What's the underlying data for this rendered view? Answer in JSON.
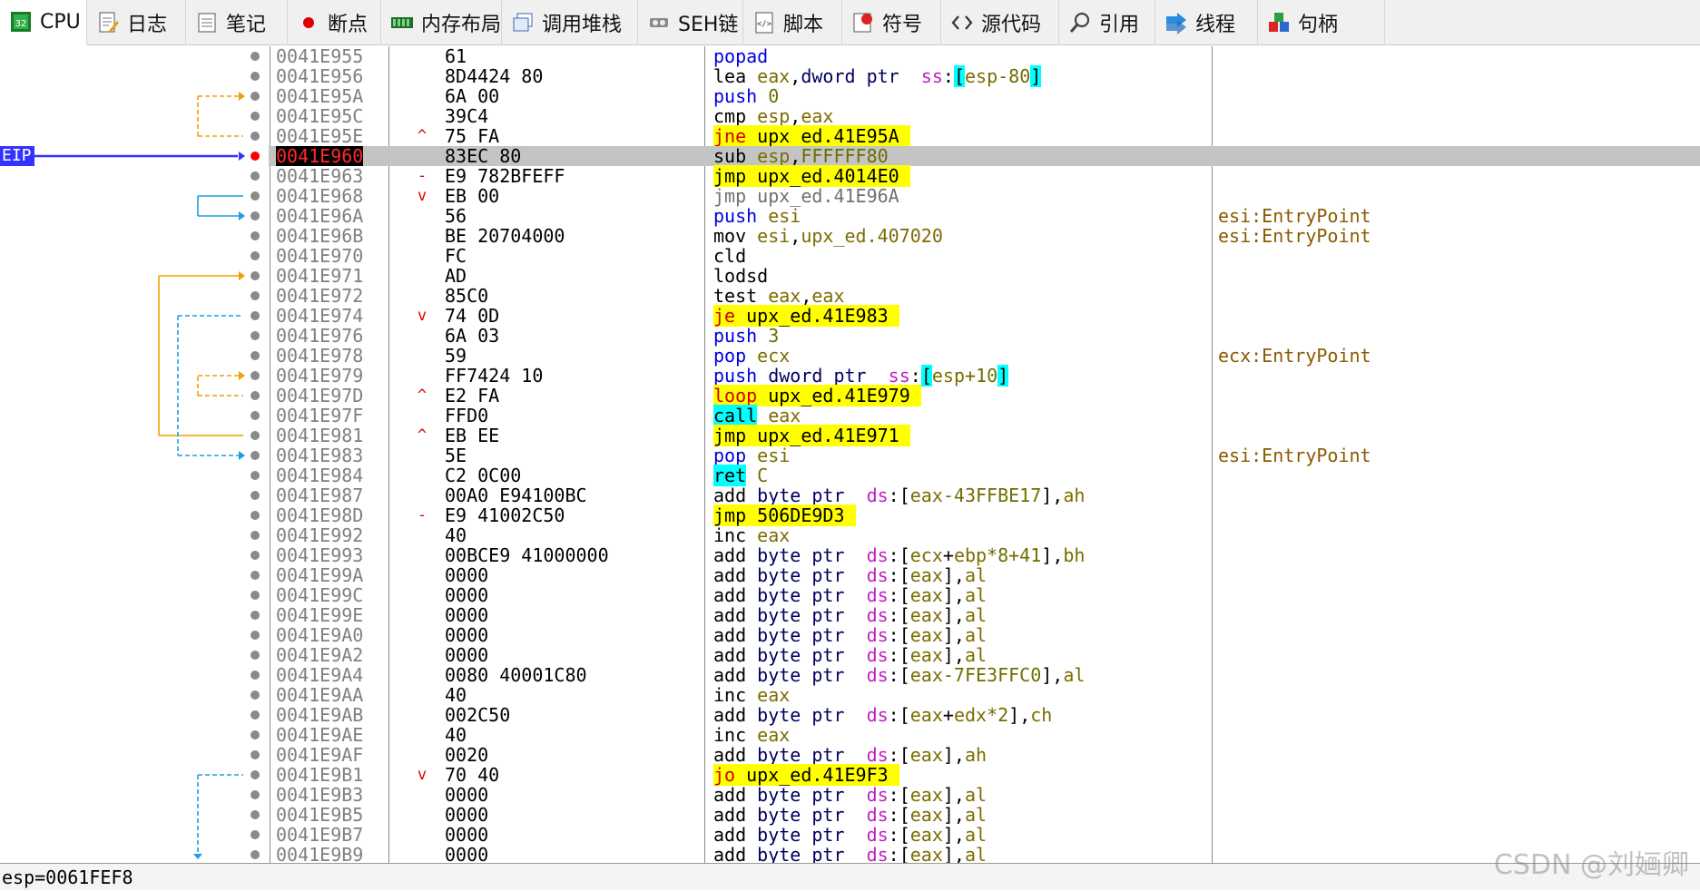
{
  "tabs": [
    {
      "label": "CPU",
      "icon": "cpu-icon",
      "active": true
    },
    {
      "label": "日志",
      "icon": "log-icon"
    },
    {
      "label": "笔记",
      "icon": "notes-icon"
    },
    {
      "label": "断点",
      "icon": "breakpoint-icon"
    },
    {
      "label": "内存布局",
      "icon": "memory-map-icon"
    },
    {
      "label": "调用堆栈",
      "icon": "call-stack-icon"
    },
    {
      "label": "SEH链",
      "icon": "seh-chain-icon"
    },
    {
      "label": "脚本",
      "icon": "script-icon"
    },
    {
      "label": "符号",
      "icon": "symbols-icon"
    },
    {
      "label": "源代码",
      "icon": "source-code-icon"
    },
    {
      "label": "引用",
      "icon": "references-icon"
    },
    {
      "label": "线程",
      "icon": "threads-icon"
    },
    {
      "label": "句柄",
      "icon": "handles-icon"
    }
  ],
  "eip_label": "EIP",
  "rows": [
    {
      "addr": "0041E955",
      "bytes": "61",
      "jm": "",
      "dis": [
        [
          "popad",
          "tk-blue",
          ""
        ]
      ]
    },
    {
      "addr": "0041E956",
      "bytes": "8D4424 80",
      "jm": "",
      "dis": [
        [
          "lea ",
          "tk-mn",
          ""
        ],
        [
          "eax",
          "tk-reg",
          ""
        ],
        [
          ",",
          "tk-mn",
          ""
        ],
        [
          "dword ptr ",
          "tk-ptr",
          ""
        ],
        [
          " ss",
          "tk-seg",
          ""
        ],
        [
          ":",
          "tk-mn",
          ""
        ],
        [
          "[",
          "tk-mn",
          "hl-c"
        ],
        [
          "esp",
          "tk-reg",
          ""
        ],
        [
          "-80",
          "tk-imm",
          ""
        ],
        [
          "]",
          "tk-mn",
          "hl-c"
        ]
      ]
    },
    {
      "addr": "0041E95A",
      "bytes": "6A 00",
      "jm": "",
      "dis": [
        [
          "push ",
          "tk-blue",
          ""
        ],
        [
          "0",
          "tk-imm",
          ""
        ]
      ]
    },
    {
      "addr": "0041E95C",
      "bytes": "39C4",
      "jm": "",
      "dis": [
        [
          "cmp ",
          "tk-mn",
          ""
        ],
        [
          "esp",
          "tk-reg",
          ""
        ],
        [
          ",",
          "tk-mn",
          ""
        ],
        [
          "eax",
          "tk-reg",
          ""
        ]
      ]
    },
    {
      "addr": "0041E95E",
      "bytes": "75 FA",
      "jm": "^",
      "dis": [
        [
          "jne",
          "tk-red",
          "hl-y"
        ],
        [
          " upx_ed.41E95A ",
          "tk-mn",
          "hl-y"
        ]
      ]
    },
    {
      "addr": "0041E960",
      "bytes": "83EC 80",
      "jm": "",
      "eip": true,
      "dis": [
        [
          "sub ",
          "tk-mn",
          ""
        ],
        [
          "esp",
          "tk-reg",
          ""
        ],
        [
          ",",
          "tk-mn",
          ""
        ],
        [
          "FFFFFF80",
          "tk-imm",
          ""
        ]
      ]
    },
    {
      "addr": "0041E963",
      "bytes": "E9 782BFEFF",
      "jm": "-",
      "dis": [
        [
          "jmp ",
          "tk-mn",
          "hl-y"
        ],
        [
          "upx_ed.4014E0 ",
          "tk-mn",
          "hl-y"
        ]
      ]
    },
    {
      "addr": "0041E968",
      "bytes": "EB 00",
      "jm": "v",
      "dis": [
        [
          "jmp upx_ed.41E96A",
          "tk-gray",
          ""
        ]
      ]
    },
    {
      "addr": "0041E96A",
      "bytes": "56",
      "jm": "",
      "dis": [
        [
          "push ",
          "tk-blue",
          ""
        ],
        [
          "esi",
          "tk-reg",
          ""
        ]
      ],
      "cmt": "esi:EntryPoint"
    },
    {
      "addr": "0041E96B",
      "bytes": "BE 20704000",
      "jm": "",
      "dis": [
        [
          "mov ",
          "tk-mn",
          ""
        ],
        [
          "esi",
          "tk-reg",
          ""
        ],
        [
          ",",
          "tk-mn",
          ""
        ],
        [
          "upx_ed.407020",
          "tk-addr",
          ""
        ]
      ],
      "cmt": "esi:EntryPoint"
    },
    {
      "addr": "0041E970",
      "bytes": "FC",
      "jm": "",
      "dis": [
        [
          "cld",
          "tk-mn",
          ""
        ]
      ]
    },
    {
      "addr": "0041E971",
      "bytes": "AD",
      "jm": "",
      "dis": [
        [
          "lodsd",
          "tk-mn",
          ""
        ]
      ]
    },
    {
      "addr": "0041E972",
      "bytes": "85C0",
      "jm": "",
      "dis": [
        [
          "test ",
          "tk-mn",
          ""
        ],
        [
          "eax",
          "tk-reg",
          ""
        ],
        [
          ",",
          "tk-mn",
          ""
        ],
        [
          "eax",
          "tk-reg",
          ""
        ]
      ]
    },
    {
      "addr": "0041E974",
      "bytes": "74 0D",
      "jm": "v",
      "dis": [
        [
          "je",
          "tk-red",
          "hl-y"
        ],
        [
          " upx_ed.41E983 ",
          "tk-mn",
          "hl-y"
        ]
      ]
    },
    {
      "addr": "0041E976",
      "bytes": "6A 03",
      "jm": "",
      "dis": [
        [
          "push ",
          "tk-blue",
          ""
        ],
        [
          "3",
          "tk-imm",
          ""
        ]
      ]
    },
    {
      "addr": "0041E978",
      "bytes": "59",
      "jm": "",
      "dis": [
        [
          "pop ",
          "tk-blue",
          ""
        ],
        [
          "ecx",
          "tk-reg",
          ""
        ]
      ],
      "cmt": "ecx:EntryPoint"
    },
    {
      "addr": "0041E979",
      "bytes": "FF7424 10",
      "jm": "",
      "dis": [
        [
          "push ",
          "tk-blue",
          ""
        ],
        [
          "dword ptr ",
          "tk-ptr",
          ""
        ],
        [
          " ss",
          "tk-seg",
          ""
        ],
        [
          ":",
          "tk-mn",
          ""
        ],
        [
          "[",
          "tk-mn",
          "hl-c"
        ],
        [
          "esp",
          "tk-reg",
          ""
        ],
        [
          "+10",
          "tk-imm",
          ""
        ],
        [
          "]",
          "tk-mn",
          "hl-c"
        ]
      ]
    },
    {
      "addr": "0041E97D",
      "bytes": "E2 FA",
      "jm": "^",
      "dis": [
        [
          "loop",
          "tk-red",
          "hl-y"
        ],
        [
          " upx_ed.41E979 ",
          "tk-mn",
          "hl-y"
        ]
      ]
    },
    {
      "addr": "0041E97F",
      "bytes": "FFD0",
      "jm": "",
      "dis": [
        [
          "call",
          "tk-mn",
          "hl-c"
        ],
        [
          " eax",
          "tk-reg",
          ""
        ]
      ]
    },
    {
      "addr": "0041E981",
      "bytes": "EB EE",
      "jm": "^",
      "dis": [
        [
          "jmp ",
          "tk-mn",
          "hl-y"
        ],
        [
          "upx_ed.41E971 ",
          "tk-mn",
          "hl-y"
        ]
      ]
    },
    {
      "addr": "0041E983",
      "bytes": "5E",
      "jm": "",
      "dis": [
        [
          "pop ",
          "tk-blue",
          ""
        ],
        [
          "esi",
          "tk-reg",
          ""
        ]
      ],
      "cmt": "esi:EntryPoint"
    },
    {
      "addr": "0041E984",
      "bytes": "C2 0C00",
      "jm": "",
      "dis": [
        [
          "ret",
          "tk-mn",
          "hl-c"
        ],
        [
          " C",
          "tk-imm",
          ""
        ]
      ]
    },
    {
      "addr": "0041E987",
      "bytes": "00A0 E94100BC",
      "jm": "",
      "dis": [
        [
          "add ",
          "tk-mn",
          ""
        ],
        [
          "byte ptr ",
          "tk-ptr",
          ""
        ],
        [
          " ds",
          "tk-seg",
          ""
        ],
        [
          ":[",
          "tk-mn",
          ""
        ],
        [
          "eax",
          "tk-reg",
          ""
        ],
        [
          "-43FFBE17",
          "tk-imm",
          ""
        ],
        [
          "],",
          "tk-mn",
          ""
        ],
        [
          "ah",
          "tk-reg",
          ""
        ]
      ]
    },
    {
      "addr": "0041E98D",
      "bytes": "E9 41002C50",
      "jm": "-",
      "dis": [
        [
          "jmp ",
          "tk-mn",
          "hl-y"
        ],
        [
          "506DE9D3 ",
          "tk-mn",
          "hl-y"
        ]
      ]
    },
    {
      "addr": "0041E992",
      "bytes": "40",
      "jm": "",
      "dis": [
        [
          "inc ",
          "tk-mn",
          ""
        ],
        [
          "eax",
          "tk-reg",
          ""
        ]
      ]
    },
    {
      "addr": "0041E993",
      "bytes": "00BCE9 41000000",
      "jm": "",
      "dis": [
        [
          "add ",
          "tk-mn",
          ""
        ],
        [
          "byte ptr ",
          "tk-ptr",
          ""
        ],
        [
          " ds",
          "tk-seg",
          ""
        ],
        [
          ":[",
          "tk-mn",
          ""
        ],
        [
          "ecx",
          "tk-reg",
          ""
        ],
        [
          "+",
          "tk-mn",
          ""
        ],
        [
          "ebp",
          "tk-reg",
          ""
        ],
        [
          "*8+41",
          "tk-imm",
          ""
        ],
        [
          "],",
          "tk-mn",
          ""
        ],
        [
          "bh",
          "tk-reg",
          ""
        ]
      ]
    },
    {
      "addr": "0041E99A",
      "bytes": "0000",
      "jm": "",
      "dis": [
        [
          "add ",
          "tk-mn",
          ""
        ],
        [
          "byte ptr ",
          "tk-ptr",
          ""
        ],
        [
          " ds",
          "tk-seg",
          ""
        ],
        [
          ":[",
          "tk-mn",
          ""
        ],
        [
          "eax",
          "tk-reg",
          ""
        ],
        [
          "],",
          "tk-mn",
          ""
        ],
        [
          "al",
          "tk-reg",
          ""
        ]
      ]
    },
    {
      "addr": "0041E99C",
      "bytes": "0000",
      "jm": "",
      "dis": [
        [
          "add ",
          "tk-mn",
          ""
        ],
        [
          "byte ptr ",
          "tk-ptr",
          ""
        ],
        [
          " ds",
          "tk-seg",
          ""
        ],
        [
          ":[",
          "tk-mn",
          ""
        ],
        [
          "eax",
          "tk-reg",
          ""
        ],
        [
          "],",
          "tk-mn",
          ""
        ],
        [
          "al",
          "tk-reg",
          ""
        ]
      ]
    },
    {
      "addr": "0041E99E",
      "bytes": "0000",
      "jm": "",
      "dis": [
        [
          "add ",
          "tk-mn",
          ""
        ],
        [
          "byte ptr ",
          "tk-ptr",
          ""
        ],
        [
          " ds",
          "tk-seg",
          ""
        ],
        [
          ":[",
          "tk-mn",
          ""
        ],
        [
          "eax",
          "tk-reg",
          ""
        ],
        [
          "],",
          "tk-mn",
          ""
        ],
        [
          "al",
          "tk-reg",
          ""
        ]
      ]
    },
    {
      "addr": "0041E9A0",
      "bytes": "0000",
      "jm": "",
      "dis": [
        [
          "add ",
          "tk-mn",
          ""
        ],
        [
          "byte ptr ",
          "tk-ptr",
          ""
        ],
        [
          " ds",
          "tk-seg",
          ""
        ],
        [
          ":[",
          "tk-mn",
          ""
        ],
        [
          "eax",
          "tk-reg",
          ""
        ],
        [
          "],",
          "tk-mn",
          ""
        ],
        [
          "al",
          "tk-reg",
          ""
        ]
      ]
    },
    {
      "addr": "0041E9A2",
      "bytes": "0000",
      "jm": "",
      "dis": [
        [
          "add ",
          "tk-mn",
          ""
        ],
        [
          "byte ptr ",
          "tk-ptr",
          ""
        ],
        [
          " ds",
          "tk-seg",
          ""
        ],
        [
          ":[",
          "tk-mn",
          ""
        ],
        [
          "eax",
          "tk-reg",
          ""
        ],
        [
          "],",
          "tk-mn",
          ""
        ],
        [
          "al",
          "tk-reg",
          ""
        ]
      ]
    },
    {
      "addr": "0041E9A4",
      "bytes": "0080 40001C80",
      "jm": "",
      "dis": [
        [
          "add ",
          "tk-mn",
          ""
        ],
        [
          "byte ptr ",
          "tk-ptr",
          ""
        ],
        [
          " ds",
          "tk-seg",
          ""
        ],
        [
          ":[",
          "tk-mn",
          ""
        ],
        [
          "eax",
          "tk-reg",
          ""
        ],
        [
          "-7FE3FFC0",
          "tk-imm",
          ""
        ],
        [
          "],",
          "tk-mn",
          ""
        ],
        [
          "al",
          "tk-reg",
          ""
        ]
      ]
    },
    {
      "addr": "0041E9AA",
      "bytes": "40",
      "jm": "",
      "dis": [
        [
          "inc ",
          "tk-mn",
          ""
        ],
        [
          "eax",
          "tk-reg",
          ""
        ]
      ]
    },
    {
      "addr": "0041E9AB",
      "bytes": "002C50",
      "jm": "",
      "dis": [
        [
          "add ",
          "tk-mn",
          ""
        ],
        [
          "byte ptr ",
          "tk-ptr",
          ""
        ],
        [
          " ds",
          "tk-seg",
          ""
        ],
        [
          ":[",
          "tk-mn",
          ""
        ],
        [
          "eax",
          "tk-reg",
          ""
        ],
        [
          "+",
          "tk-mn",
          ""
        ],
        [
          "edx",
          "tk-reg",
          ""
        ],
        [
          "*2",
          "tk-imm",
          ""
        ],
        [
          "],",
          "tk-mn",
          ""
        ],
        [
          "ch",
          "tk-reg",
          ""
        ]
      ]
    },
    {
      "addr": "0041E9AE",
      "bytes": "40",
      "jm": "",
      "dis": [
        [
          "inc ",
          "tk-mn",
          ""
        ],
        [
          "eax",
          "tk-reg",
          ""
        ]
      ]
    },
    {
      "addr": "0041E9AF",
      "bytes": "0020",
      "jm": "",
      "dis": [
        [
          "add ",
          "tk-mn",
          ""
        ],
        [
          "byte ptr ",
          "tk-ptr",
          ""
        ],
        [
          " ds",
          "tk-seg",
          ""
        ],
        [
          ":[",
          "tk-mn",
          ""
        ],
        [
          "eax",
          "tk-reg",
          ""
        ],
        [
          "],",
          "tk-mn",
          ""
        ],
        [
          "ah",
          "tk-reg",
          ""
        ]
      ]
    },
    {
      "addr": "0041E9B1",
      "bytes": "70 40",
      "jm": "v",
      "dis": [
        [
          "jo",
          "tk-red",
          "hl-y"
        ],
        [
          " upx_ed.41E9F3 ",
          "tk-mn",
          "hl-y"
        ]
      ]
    },
    {
      "addr": "0041E9B3",
      "bytes": "0000",
      "jm": "",
      "dis": [
        [
          "add ",
          "tk-mn",
          ""
        ],
        [
          "byte ptr ",
          "tk-ptr",
          ""
        ],
        [
          " ds",
          "tk-seg",
          ""
        ],
        [
          ":[",
          "tk-mn",
          ""
        ],
        [
          "eax",
          "tk-reg",
          ""
        ],
        [
          "],",
          "tk-mn",
          ""
        ],
        [
          "al",
          "tk-reg",
          ""
        ]
      ]
    },
    {
      "addr": "0041E9B5",
      "bytes": "0000",
      "jm": "",
      "dis": [
        [
          "add ",
          "tk-mn",
          ""
        ],
        [
          "byte ptr ",
          "tk-ptr",
          ""
        ],
        [
          " ds",
          "tk-seg",
          ""
        ],
        [
          ":[",
          "tk-mn",
          ""
        ],
        [
          "eax",
          "tk-reg",
          ""
        ],
        [
          "],",
          "tk-mn",
          ""
        ],
        [
          "al",
          "tk-reg",
          ""
        ]
      ]
    },
    {
      "addr": "0041E9B7",
      "bytes": "0000",
      "jm": "",
      "dis": [
        [
          "add ",
          "tk-mn",
          ""
        ],
        [
          "byte ptr ",
          "tk-ptr",
          ""
        ],
        [
          " ds",
          "tk-seg",
          ""
        ],
        [
          ":[",
          "tk-mn",
          ""
        ],
        [
          "eax",
          "tk-reg",
          ""
        ],
        [
          "],",
          "tk-mn",
          ""
        ],
        [
          "al",
          "tk-reg",
          ""
        ]
      ]
    },
    {
      "addr": "0041E9B9",
      "bytes": "0000",
      "jm": "",
      "dis": [
        [
          "add ",
          "tk-mn",
          ""
        ],
        [
          "byte ptr ",
          "tk-ptr",
          ""
        ],
        [
          " ds",
          "tk-seg",
          ""
        ],
        [
          ":[",
          "tk-mn",
          ""
        ],
        [
          "eax",
          "tk-reg",
          ""
        ],
        [
          "],",
          "tk-mn",
          ""
        ],
        [
          "al",
          "tk-reg",
          ""
        ]
      ]
    }
  ],
  "status_text": "esp=0061FEF8",
  "watermark": "CSDN @刘婳卿",
  "colors": {
    "eip_blue": "#3333ff",
    "jump_orange": "#f0a000",
    "jump_cyan": "#1a9ee6",
    "highlight_yellow": "#ffff00",
    "highlight_cyan": "#00ffff",
    "breakpoint_red": "#ff0000"
  }
}
